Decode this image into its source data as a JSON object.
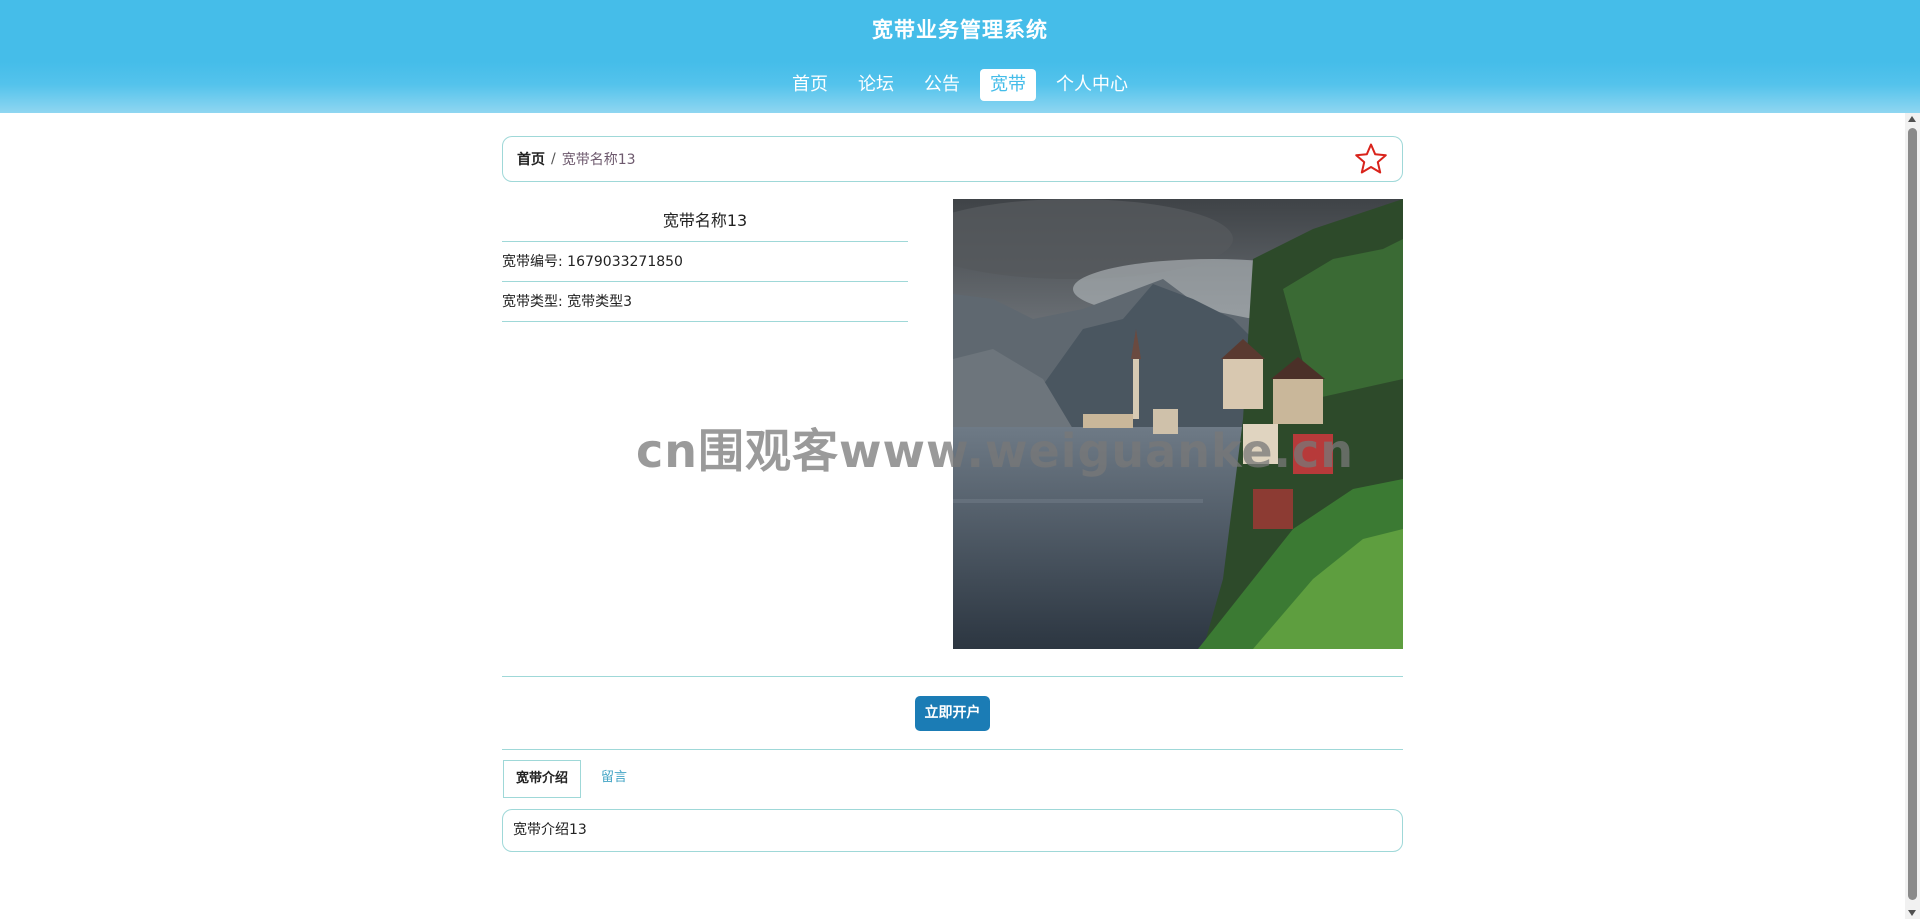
{
  "header": {
    "title": "宽带业务管理系统",
    "nav": [
      {
        "label": "首页",
        "active": false
      },
      {
        "label": "论坛",
        "active": false
      },
      {
        "label": "公告",
        "active": false
      },
      {
        "label": "宽带",
        "active": true
      },
      {
        "label": "个人中心",
        "active": false
      }
    ],
    "accent_color": "#45bde9"
  },
  "breadcrumb": {
    "home": "首页",
    "separator": "/",
    "current": "宽带名称13",
    "favorite_icon": "star-outline-icon",
    "favorite_color": "#d9231b"
  },
  "detail": {
    "name": "宽带名称13",
    "fields": [
      {
        "label": "宽带编号:",
        "value": "1679033271850"
      },
      {
        "label": "宽带类型:",
        "value": "宽带类型3"
      }
    ],
    "image_subject": "lakeside village with mountains"
  },
  "watermark": "cn围观客www.weiguanke.cn",
  "actions": {
    "open_button": "立即开户",
    "button_color": "#1b7cb5"
  },
  "tabs": [
    {
      "label": "宽带介绍",
      "active": true
    },
    {
      "label": "留言",
      "active": false
    }
  ],
  "intro_text": "宽带介绍13"
}
